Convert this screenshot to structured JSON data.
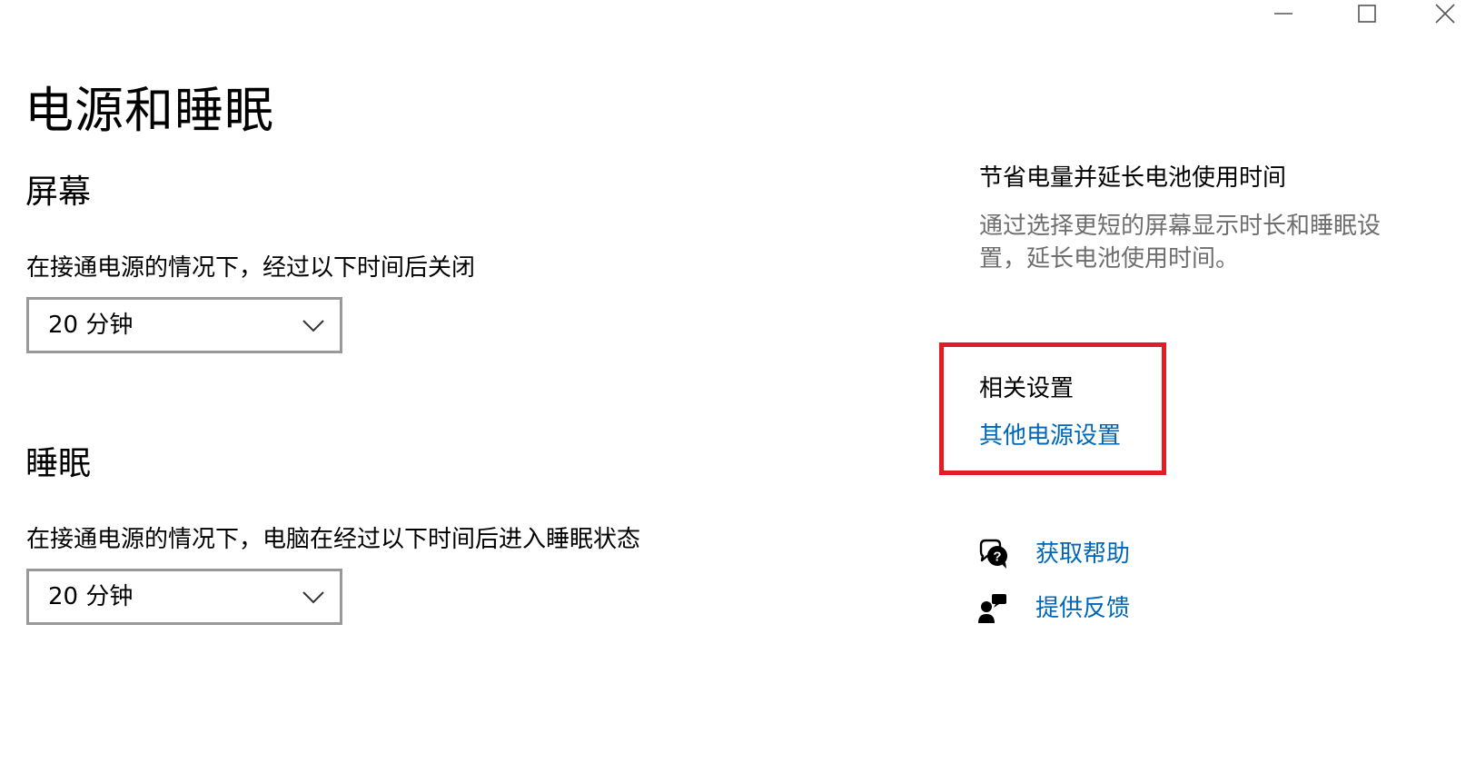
{
  "window": {
    "controls": [
      "minimize-icon",
      "maximize-icon",
      "close-icon"
    ]
  },
  "page": {
    "title": "电源和睡眠"
  },
  "screen": {
    "title": "屏幕",
    "label": "在接通电源的情况下，经过以下时间后关闭",
    "value": "20 分钟"
  },
  "sleep": {
    "title": "睡眠",
    "label": "在接通电源的情况下，电脑在经过以下时间后进入睡眠状态",
    "value": "20 分钟"
  },
  "tip": {
    "title": "节省电量并延长电池使用时间",
    "text": "通过选择更短的屏幕显示时长和睡眠设置，延长电池使用时间。"
  },
  "related": {
    "title": "相关设置",
    "link": "其他电源设置"
  },
  "help": {
    "get_help": "获取帮助",
    "feedback": "提供反馈"
  },
  "colors": {
    "link": "#0067b8",
    "highlight": "#e31b23",
    "secondary_text": "#6e6e6e",
    "dropdown_border": "#999999"
  }
}
